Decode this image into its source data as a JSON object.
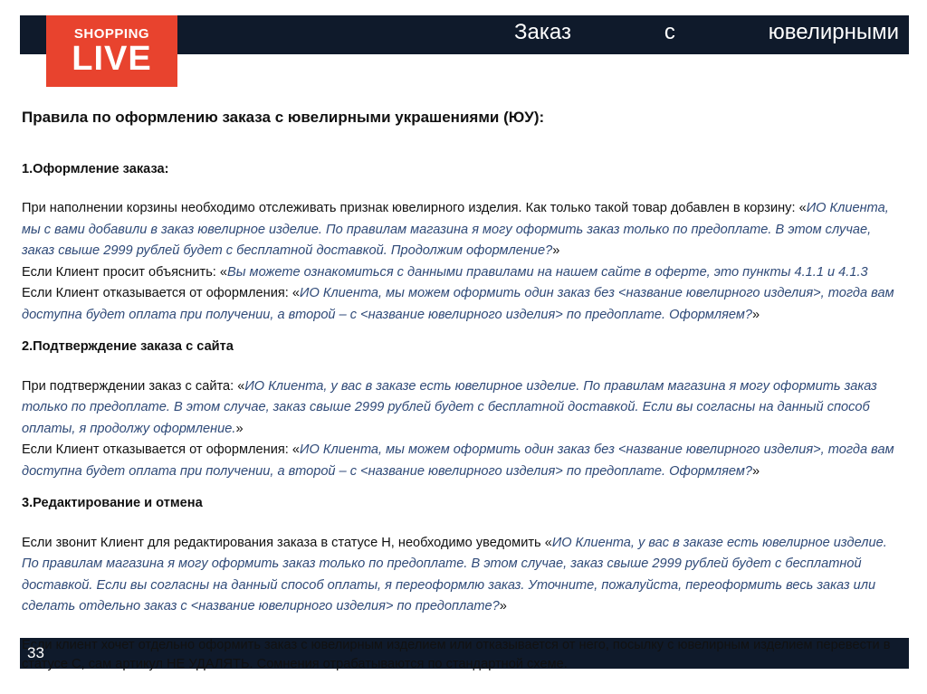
{
  "header": {
    "title_words": [
      "Заказ",
      "с",
      "ювелирными"
    ],
    "logo_line1": "SHOPPING",
    "logo_line2": "LIVE",
    "accent": "#e8432e",
    "bar_color": "#0f1a2b"
  },
  "main": {
    "heading": "Правила по оформлению заказа с ювелирными украшениями (ЮУ):",
    "s1": {
      "title": "1.Оформление заказа:",
      "p1_text": "При наполнении корзины необходимо отслеживать признак ювелирного изделия. Как только такой товар добавлен в корзину: «",
      "p1_quote": "ИО Клиента, мы с вами добавили в заказ ювелирное изделие. По правилам магазина я могу оформить заказ только по предоплате. В этом случае, заказ свыше 2999 рублей будет с бесплатной доставкой. Продолжим оформление?",
      "p2_text": "Если Клиент просит объяснить: «",
      "p2_quote": "Вы можете ознакомиться с данными правилами на нашем сайте в оферте, это пункты 4.1.1 и 4.1.3",
      "p3_text": "Если Клиент отказывается от оформления: «",
      "p3_quote": "ИО Клиента, мы можем оформить один заказ без <название ювелирного изделия>, тогда вам доступна будет оплата при получении, а второй – с <название ювелирного изделия> по предоплате. Оформляем?"
    },
    "s2": {
      "title": "2.Подтверждение заказа с сайта",
      "p1_text": "При подтверждении заказ с сайта: «",
      "p1_quote": "ИО Клиента, у вас в заказе есть ювелирное изделие. По правилам магазина я могу оформить заказ только по предоплате. В этом случае, заказ свыше 2999 рублей будет с бесплатной доставкой. Если вы согласны на данный способ оплаты, я продолжу оформление.",
      "p2_text": "Если Клиент отказывается от оформления: «",
      "p2_quote": "ИО Клиента, мы можем оформить один заказ без <название ювелирного изделия>, тогда вам доступна будет оплата при получении, а второй – с <название ювелирного изделия> по предоплате. Оформляем?"
    },
    "s3": {
      "title": "3.Редактирование и отмена",
      "p1_text": "Если звонит Клиент для редактирования заказа в статусе Н, необходимо уведомить «",
      "p1_quote": "ИО Клиента, у вас в заказе есть ювелирное изделие. По правилам магазина я могу оформить заказ только по предоплате. В этом случае, заказ свыше 2999 рублей будет с бесплатной доставкой. Если вы согласны на данный способ оплаты, я переоформлю заказ. Уточните, пожалуйста, переоформить весь заказ или сделать отдельно заказ с <название ювелирного изделия> по предоплате?",
      "p2": "Если клиент хочет отдельно оформить заказ с ювелирным изделием или отказывается от него, посылку с ювелирным изделием перевести в статусе С, сам артикул НЕ УДАЛЯТЬ. Сомнения отрабатываются по стандартной схеме."
    },
    "quote_close": "»"
  },
  "footer": {
    "page_number": "33"
  }
}
